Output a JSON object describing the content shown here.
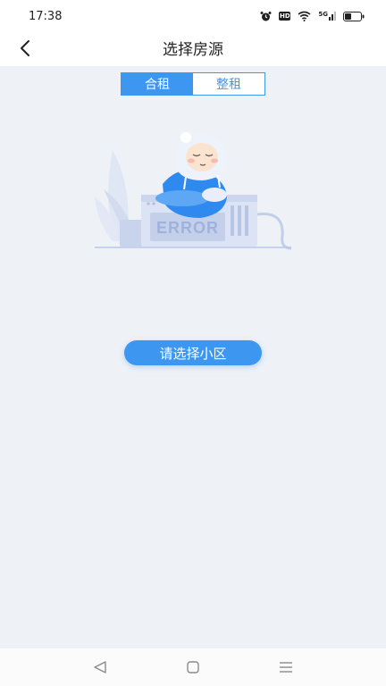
{
  "status_bar": {
    "time": "17:38",
    "icons": [
      "alarm-icon",
      "hd-icon",
      "wifi-icon",
      "5g-signal-icon",
      "battery-icon"
    ],
    "hd_label": "HD",
    "network_label": "5G"
  },
  "header": {
    "title": "选择房源",
    "back_icon": "chevron-left-icon"
  },
  "tabs": [
    {
      "label": "合租",
      "active": true
    },
    {
      "label": "整租",
      "active": false
    }
  ],
  "illustration": {
    "error_text": "ERROR"
  },
  "main": {
    "select_button_label": "请选择小区"
  },
  "system_nav": {
    "icons": [
      "back-triangle-icon",
      "home-square-icon",
      "menu-lines-icon"
    ]
  },
  "colors": {
    "accent": "#3d97f0",
    "background": "#eef1f6"
  }
}
